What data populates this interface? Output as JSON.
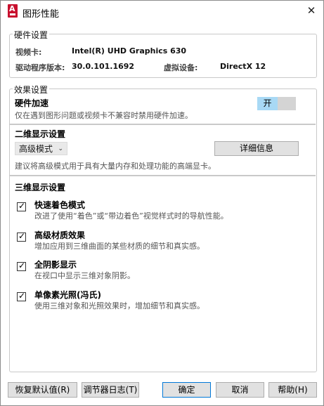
{
  "window": {
    "title": "图形性能",
    "close_glyph": "✕",
    "app_icon": "autocad-a-icon"
  },
  "hardware_group": {
    "title": "硬件设置",
    "video_card_label": "视频卡:",
    "video_card_value": "Intel(R) UHD Graphics 630",
    "driver_label": "驱动程序版本:",
    "driver_value": "30.0.101.1692",
    "virtual_label": "虚拟设备:",
    "virtual_value": "DirectX 12"
  },
  "effects_group": {
    "title": "效果设置",
    "hw_accel": {
      "title": "硬件加速",
      "desc": "仅在遇到图形问题或视频卡不兼容时禁用硬件加速。",
      "toggle_label": "开",
      "toggle_on": true
    },
    "display_2d": {
      "title": "二维显示设置",
      "mode_value": "高级模式",
      "chevron": "⌄",
      "details_button": "详细信息",
      "desc": "建议将高级模式用于具有大量内存和处理功能的高端显卡。"
    },
    "display_3d": {
      "title": "三维显示设置",
      "options": [
        {
          "label": "快速着色模式",
          "desc": "改进了使用“着色”或“带边着色”视觉样式时的导航性能。",
          "checked": true,
          "check": "✓"
        },
        {
          "label": "高级材质效果",
          "desc": "增加应用到三维曲面的某些材质的细节和真实感。",
          "checked": true,
          "check": "✓"
        },
        {
          "label": "全阴影显示",
          "desc": "在视口中显示三维对象阴影。",
          "checked": true,
          "check": "✓"
        },
        {
          "label": "单像素光照(冯氏)",
          "desc": "使用三维对象和光照效果时，增加细节和真实感。",
          "checked": true,
          "check": "✓"
        }
      ]
    }
  },
  "footer": {
    "restore": "恢复默认值(R)",
    "tuner_log": "调节器日志(T)",
    "ok": "确定",
    "cancel": "取消",
    "help": "帮助(H)"
  }
}
